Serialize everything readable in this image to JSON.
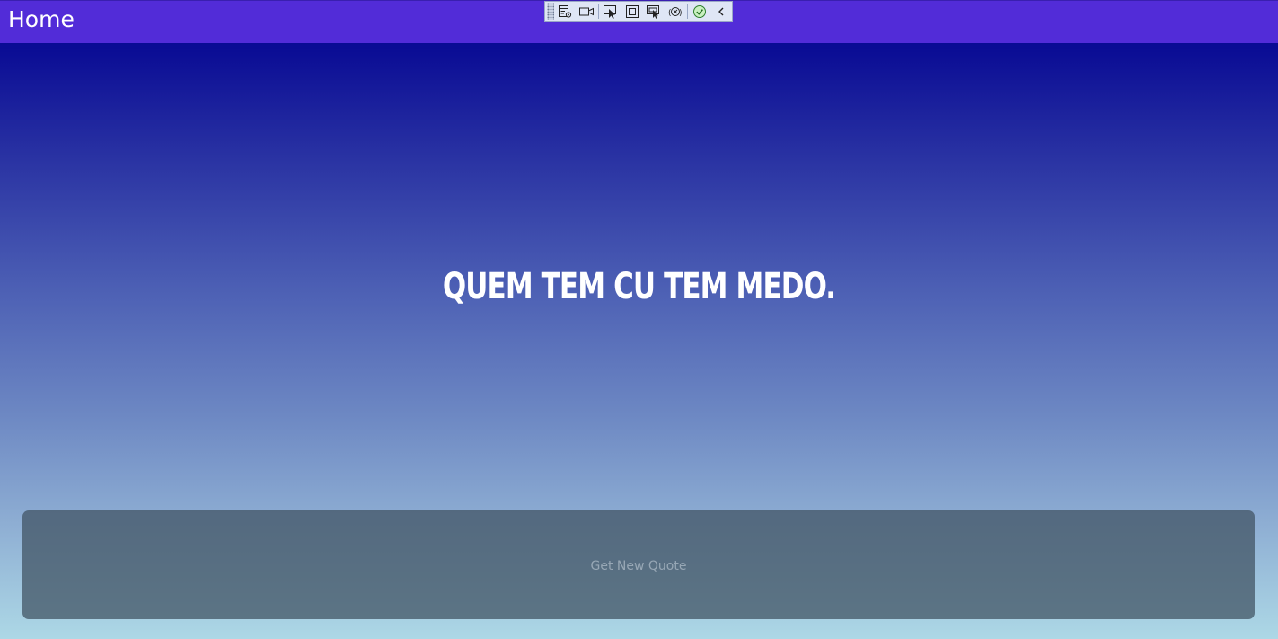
{
  "header": {
    "title": "Home",
    "background": "#522cd8"
  },
  "debug_toolbar": {
    "buttons": [
      {
        "name": "live-visual-tree-icon"
      },
      {
        "name": "record-icon"
      },
      {
        "name": "select-element-icon"
      },
      {
        "name": "display-layout-adorners-icon"
      },
      {
        "name": "track-focused-element-icon"
      },
      {
        "name": "binding-failures-icon"
      },
      {
        "name": "accessibility-check-icon"
      },
      {
        "name": "collapse-chevron-icon"
      }
    ]
  },
  "main": {
    "quote": "QUEM TEM CU TEM MEDO.",
    "button_label": "Get New Quote",
    "gradient_top": "#00008b",
    "gradient_bottom": "#add8e6"
  }
}
